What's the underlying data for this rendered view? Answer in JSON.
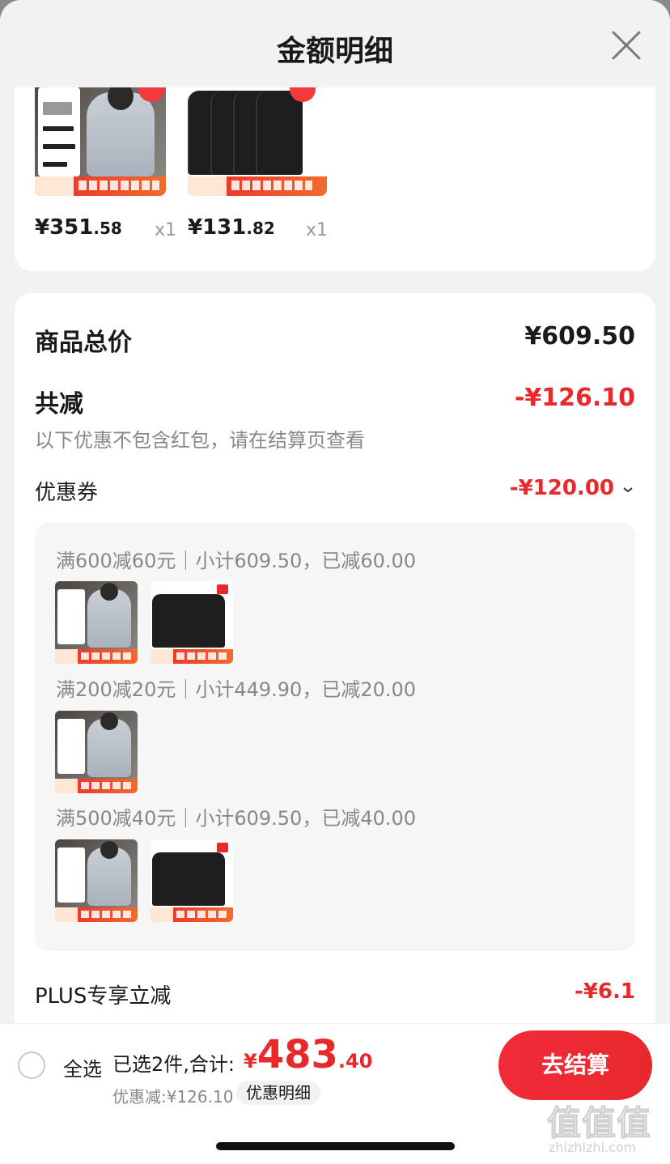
{
  "header": {
    "title": "金额明细"
  },
  "products": [
    {
      "name": "jacket",
      "price_int": "¥351",
      "price_dec": ".58",
      "qty": "x1"
    },
    {
      "name": "tshirt",
      "price_int": "¥131",
      "price_dec": ".82",
      "qty": "x1"
    }
  ],
  "summary": {
    "total_label": "商品总价",
    "total_value": "¥609.50",
    "reduce_label": "共减",
    "reduce_value": "-¥126.10",
    "note": "以下优惠不包含红包，请在结算页查看",
    "coupon_label": "优惠券",
    "coupon_value": "-¥120.00",
    "plus_label": "PLUS专享立减",
    "plus_value": "-¥6.1"
  },
  "coupons": [
    {
      "text": "满600减60元｜小计609.50，已减60.00"
    },
    {
      "text": "满200减20元｜小计449.90，已减20.00"
    },
    {
      "text": "满500减40元｜小计609.50，已减40.00"
    }
  ],
  "bottom_bar": {
    "select_all": "全选",
    "selected_summary": "已选2件,合计:",
    "total_symbol": "¥",
    "total_int": "483",
    "total_dec": ".40",
    "discount_text": "优惠减:¥126.10",
    "discount_detail": "优惠明细",
    "checkout": "去结算"
  },
  "watermark": {
    "glyphs": "值值值",
    "site": "zhizhizhi.com"
  },
  "colors": {
    "accent_red": "#e8292b",
    "background": "#f2f2f2"
  },
  "icons": {
    "close": "close-icon",
    "coupon_expand": "chevron-down-icon"
  }
}
